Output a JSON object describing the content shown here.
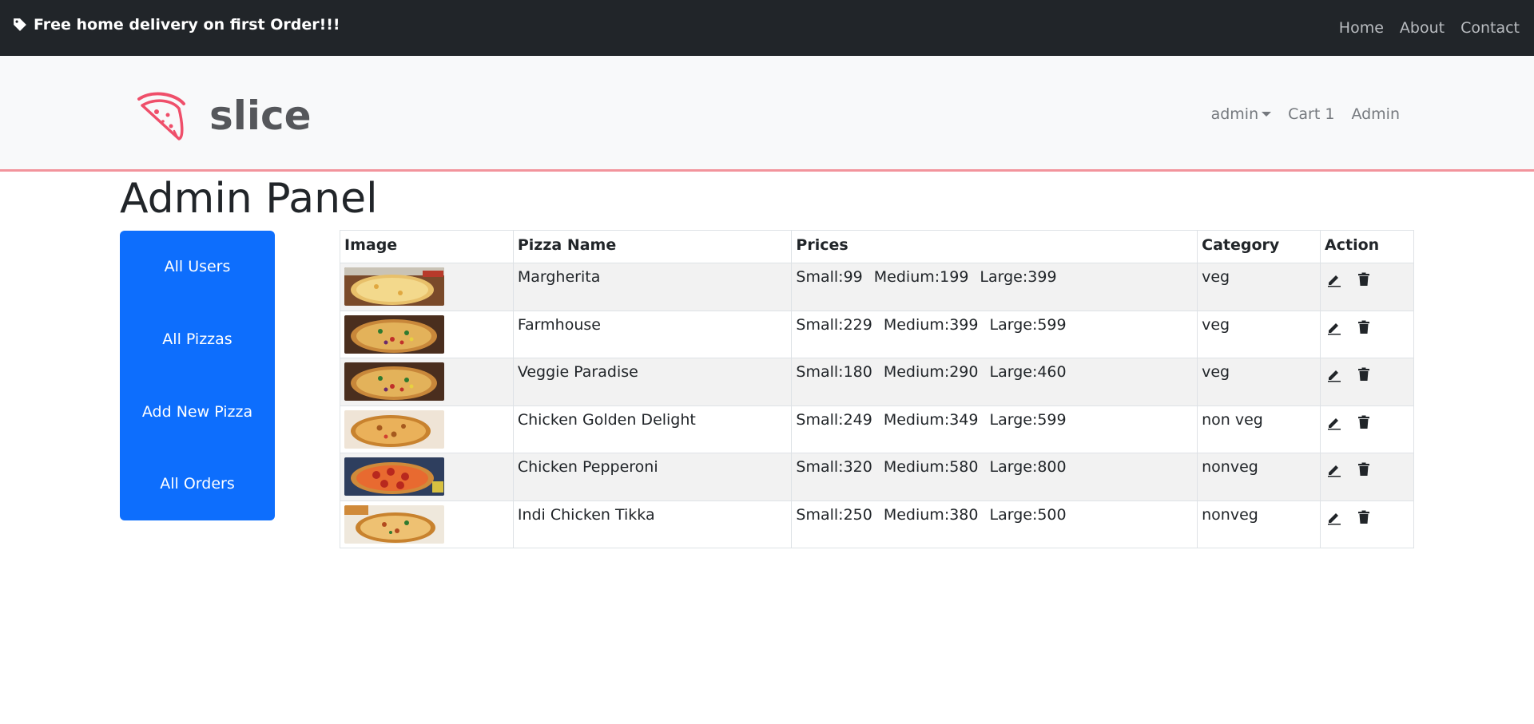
{
  "topbar": {
    "promo_icon": "tag-icon",
    "promo_text": "Free home delivery on first Order!!!",
    "links": [
      "Home",
      "About",
      "Contact"
    ]
  },
  "brand": {
    "logo_icon": "pizza-slice-icon",
    "name": "slice"
  },
  "mainnav": {
    "user": "admin",
    "cart": "Cart 1",
    "admin": "Admin"
  },
  "page": {
    "title": "Admin Panel"
  },
  "sidebar": {
    "items": [
      {
        "label": "All Users"
      },
      {
        "label": "All Pizzas"
      },
      {
        "label": "Add New Pizza"
      },
      {
        "label": "All Orders"
      }
    ]
  },
  "table": {
    "headers": [
      "Image",
      "Pizza Name",
      "Prices",
      "Category",
      "Action"
    ],
    "rows": [
      {
        "name": "Margherita",
        "small": "Small:99",
        "medium": "Medium:199",
        "large": "Large:399",
        "category": "veg",
        "thumb": "cheese"
      },
      {
        "name": "Farmhouse",
        "small": "Small:229",
        "medium": "Medium:399",
        "large": "Large:599",
        "category": "veg",
        "thumb": "veggie"
      },
      {
        "name": "Veggie Paradise",
        "small": "Small:180",
        "medium": "Medium:290",
        "large": "Large:460",
        "category": "veg",
        "thumb": "veggie"
      },
      {
        "name": "Chicken Golden Delight",
        "small": "Small:249",
        "medium": "Medium:349",
        "large": "Large:599",
        "category": "non veg",
        "thumb": "chicken"
      },
      {
        "name": "Chicken Pepperoni",
        "small": "Small:320",
        "medium": "Medium:580",
        "large": "Large:800",
        "category": "nonveg",
        "thumb": "pepperoni"
      },
      {
        "name": "Indi Chicken Tikka",
        "small": "Small:250",
        "medium": "Medium:380",
        "large": "Large:500",
        "category": "nonveg",
        "thumb": "tikka"
      }
    ],
    "action_icons": [
      "edit-icon",
      "trash-icon"
    ]
  },
  "colors": {
    "topbar": "#212529",
    "brandbar": "#f8f9fa",
    "brand_accent": "#f2949c",
    "sidebar": "#0d6efd",
    "logo_pink": "#ef4f6a"
  }
}
